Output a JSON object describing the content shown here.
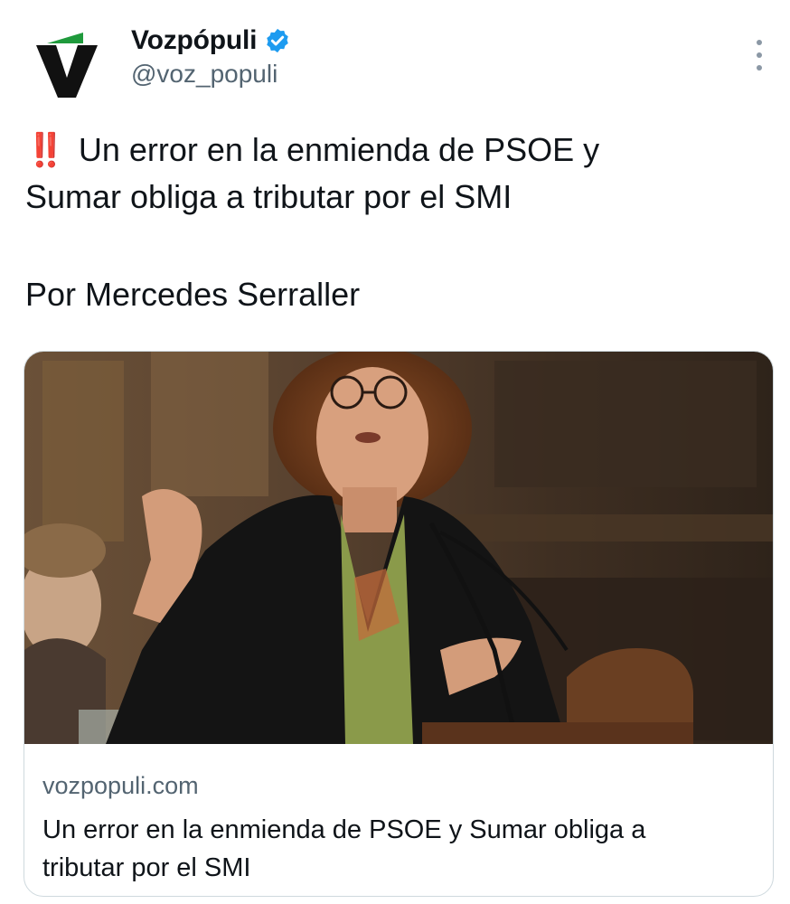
{
  "author": {
    "display_name": "Vozpópuli",
    "handle": "@voz_populi",
    "verified": true,
    "avatar_icon": "vozpopuli-logo-icon",
    "verified_icon": "verified-badge-icon",
    "more_icon": "more-options-icon"
  },
  "tweet": {
    "emoji": "‼️",
    "text_line1": "Un error en la enmienda de PSOE y",
    "text_line2": "Sumar obliga a tributar por el SMI",
    "byline": "Por Mercedes Serraller"
  },
  "card": {
    "domain": "vozpopuli.com",
    "title_line1": "Un error en la enmienda de PSOE y Sumar obliga a",
    "title_line2": "tributar por el SMI"
  },
  "colors": {
    "accent_blue": "#1d9bf0",
    "logo_green": "#1f9a3c",
    "emoji_red": "#e0202a",
    "secondary_text": "#536471"
  }
}
